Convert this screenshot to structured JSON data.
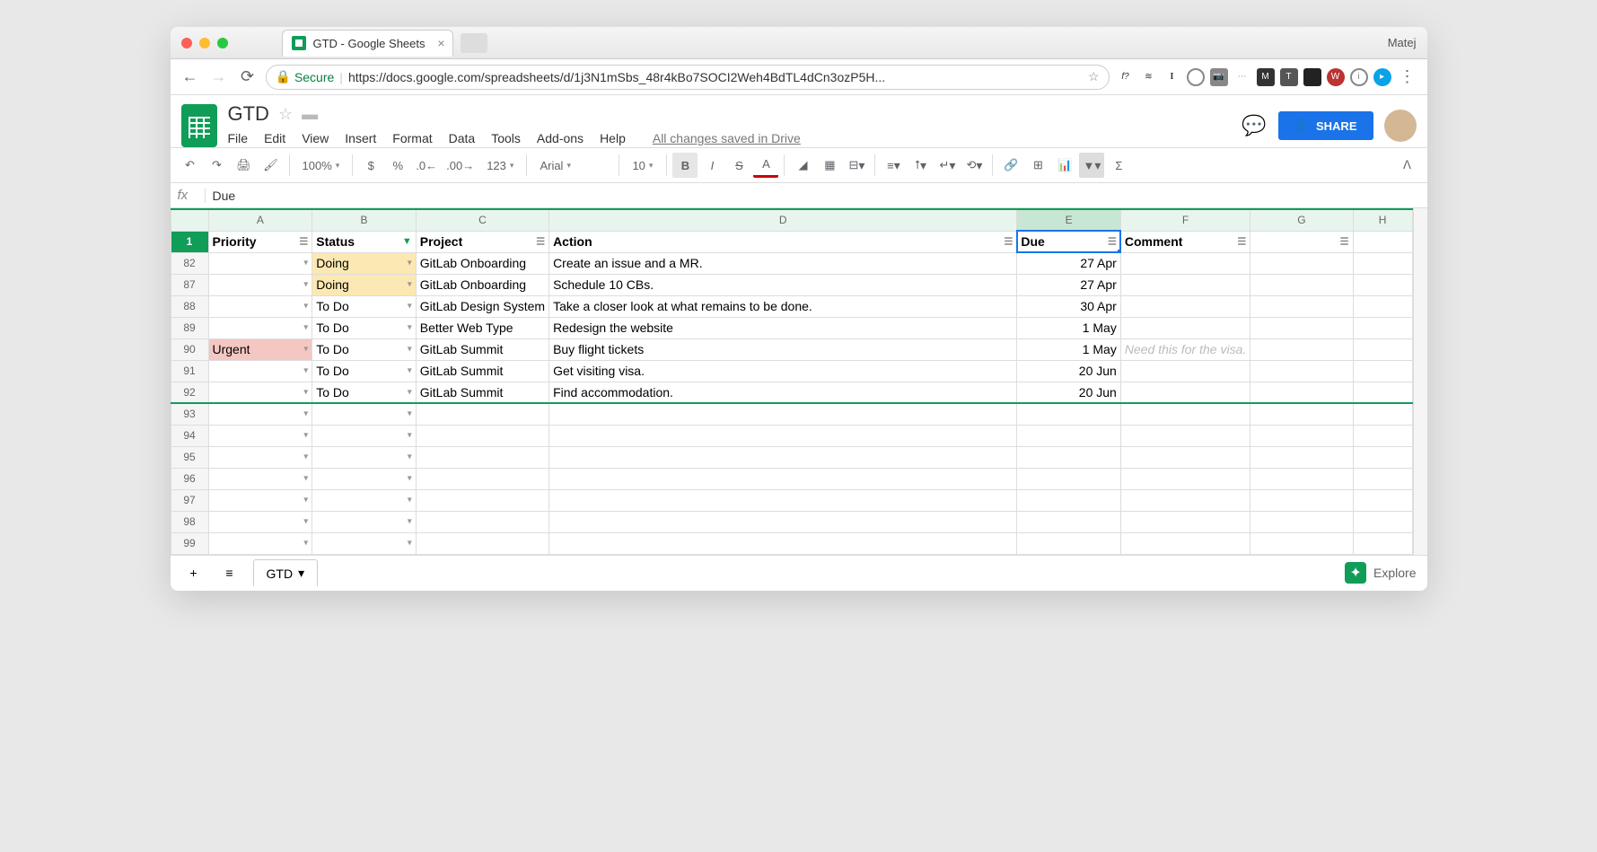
{
  "browser": {
    "tab_title": "GTD - Google Sheets",
    "user": "Matej",
    "secure_label": "Secure",
    "url": "https://docs.google.com/spreadsheets/d/1j3N1mSbs_48r4kBo7SOCI2Weh4BdTL4dCn3ozP5H..."
  },
  "doc": {
    "title": "GTD",
    "menus": [
      "File",
      "Edit",
      "View",
      "Insert",
      "Format",
      "Data",
      "Tools",
      "Add-ons",
      "Help"
    ],
    "saved": "All changes saved in Drive",
    "share": "SHARE"
  },
  "toolbar": {
    "zoom": "100%",
    "number_format": "123",
    "font": "Arial",
    "font_size": "10"
  },
  "fx": {
    "value": "Due"
  },
  "columns": [
    "A",
    "B",
    "C",
    "D",
    "E",
    "F",
    "G",
    "H"
  ],
  "header_row_num": "1",
  "headers": {
    "A": "Priority",
    "B": "Status",
    "C": "Project",
    "D": "Action",
    "E": "Due",
    "F": "Comment",
    "G": "",
    "H": ""
  },
  "rows": [
    {
      "n": "82",
      "priority": "",
      "status": "Doing",
      "status_cls": "doing",
      "project": "GitLab Onboarding",
      "action": "Create an issue and a MR.",
      "due": "27 Apr",
      "comment": ""
    },
    {
      "n": "87",
      "priority": "",
      "status": "Doing",
      "status_cls": "doing",
      "project": "GitLab Onboarding",
      "action": "Schedule 10 CBs.",
      "due": "27 Apr",
      "comment": ""
    },
    {
      "n": "88",
      "priority": "",
      "status": "To Do",
      "status_cls": "",
      "project": "GitLab Design System",
      "action": "Take a closer look at what remains to be done.",
      "due": "30 Apr",
      "comment": ""
    },
    {
      "n": "89",
      "priority": "",
      "status": "To Do",
      "status_cls": "",
      "project": "Better Web Type",
      "action": "Redesign the website",
      "due": "1 May",
      "comment": ""
    },
    {
      "n": "90",
      "priority": "Urgent",
      "priority_cls": "urgent",
      "status": "To Do",
      "status_cls": "",
      "project": "GitLab Summit",
      "action": "Buy flight tickets",
      "due": "1 May",
      "comment": "Need this for the visa.",
      "comment_faded": true
    },
    {
      "n": "91",
      "priority": "",
      "status": "To Do",
      "status_cls": "",
      "project": "GitLab Summit",
      "action": "Get visiting visa.",
      "due": "20 Jun",
      "comment": ""
    },
    {
      "n": "92",
      "priority": "",
      "status": "To Do",
      "status_cls": "",
      "project": "GitLab Summit",
      "action": "Find accommodation.",
      "due": "20 Jun",
      "comment": ""
    }
  ],
  "empty_rows": [
    "93",
    "94",
    "95",
    "96",
    "97",
    "98",
    "99"
  ],
  "bottom": {
    "sheet_name": "GTD",
    "explore": "Explore"
  }
}
